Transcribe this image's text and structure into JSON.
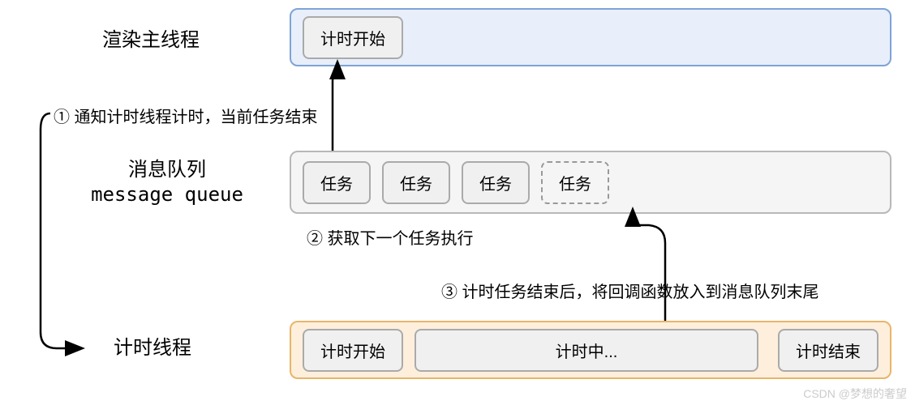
{
  "labels": {
    "render_thread": "渲染主线程",
    "message_queue_cn": "消息队列",
    "message_queue_en": "message queue",
    "timer_thread": "计时线程"
  },
  "render_lane": {
    "task": "计时开始"
  },
  "queue_lane": {
    "tasks": [
      "任务",
      "任务",
      "任务"
    ],
    "dashed_task": "任务"
  },
  "timer_lane": {
    "start": "计时开始",
    "running": "计时中...",
    "end": "计时结束"
  },
  "annotations": {
    "a1": "① 通知计时线程计时，当前任务结束",
    "a2": "② 获取下一个任务执行",
    "a3": "③ 计时任务结束后，将回调函数放入到消息队列末尾"
  },
  "watermark": "CSDN @梦想的奢望"
}
